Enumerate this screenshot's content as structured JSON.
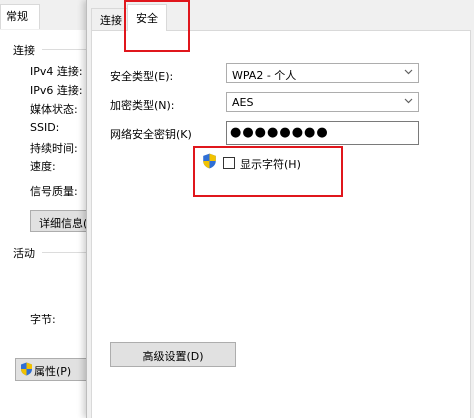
{
  "back_window": {
    "tab_label": "常规",
    "section_connection": "连接",
    "fields": [
      "IPv4 连接:",
      "IPv6 连接:",
      "媒体状态:",
      "SSID:",
      "持续时间:",
      "速度:"
    ],
    "signal_label": "信号质量:",
    "details_button": "详细信息(E)...",
    "section_activity": "活动",
    "bytes_label": "字节:",
    "properties_button": "属性(P)"
  },
  "dialog": {
    "tabs": {
      "connection": "连接",
      "security": "安全"
    },
    "security_type_label": "安全类型(E):",
    "security_type_value": "WPA2 - 个人",
    "encryption_type_label": "加密类型(N):",
    "encryption_type_value": "AES",
    "network_key_label": "网络安全密钥(K)",
    "network_key_value": "●●●●●●●●",
    "show_characters_label": "显示字符(H)",
    "show_characters_checked": false,
    "advanced_button": "高级设置(D)"
  },
  "colors": {
    "highlight": "#e0161c",
    "window_bg": "#f0f0f0",
    "panel_bg": "#ffffff"
  },
  "icons": [
    "shield-icon",
    "chevron-down-icon"
  ]
}
